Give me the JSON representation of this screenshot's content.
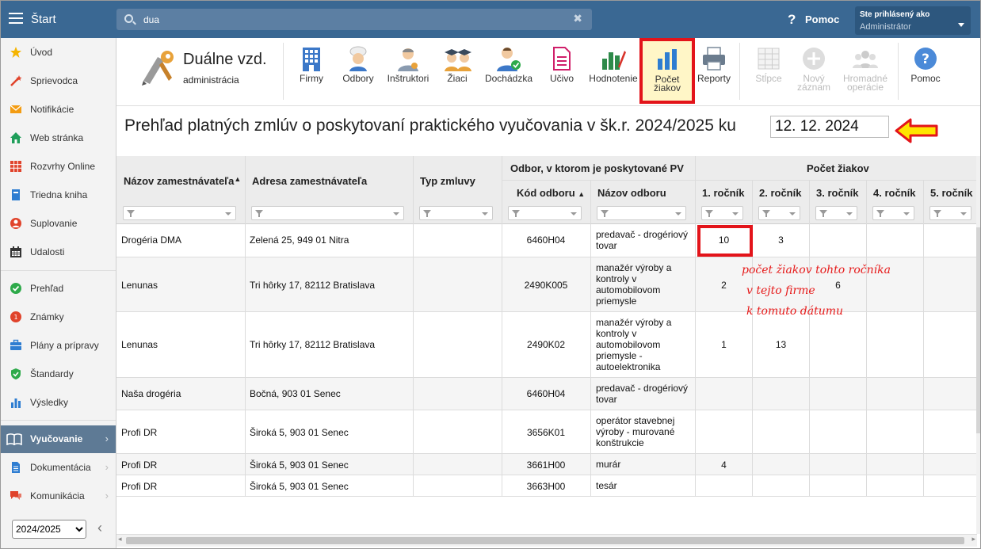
{
  "topbar": {
    "app_title": "Štart",
    "search_value": "dua",
    "help_label": "Pomoc",
    "user_label": "Ste prihlásený ako",
    "user_name": "Administrátor"
  },
  "sidebar": {
    "items": [
      {
        "label": "Úvod",
        "icon": "star-icon",
        "color": "#f5b400"
      },
      {
        "label": "Sprievodca",
        "icon": "magic-wand-icon",
        "color": "#e0432b"
      },
      {
        "label": "Notifikácie",
        "icon": "envelope-icon",
        "color": "#f39c12"
      },
      {
        "label": "Web stránka",
        "icon": "house-icon",
        "color": "#1f9e5a"
      },
      {
        "label": "Rozvrhy Online",
        "icon": "grid-calendar-icon",
        "color": "#e0432b"
      },
      {
        "label": "Triedna kniha",
        "icon": "book-icon",
        "color": "#2e7dd1"
      },
      {
        "label": "Suplovanie",
        "icon": "person-icon",
        "color": "#e0432b"
      },
      {
        "label": "Udalosti",
        "icon": "calendar-icon",
        "color": "#333333"
      },
      {
        "label": "Prehľad",
        "icon": "check-circle-icon",
        "color": "#2eaa4a"
      },
      {
        "label": "Známky",
        "icon": "grades-icon",
        "color": "#e0432b"
      },
      {
        "label": "Plány a prípravy",
        "icon": "briefcase-icon",
        "color": "#2e7dd1"
      },
      {
        "label": "Štandardy",
        "icon": "shield-check-icon",
        "color": "#2eaa4a"
      },
      {
        "label": "Výsledky",
        "icon": "bar-chart-icon",
        "color": "#2e7dd1"
      },
      {
        "label": "Vyučovanie",
        "icon": "open-book-icon",
        "color": "#ffffff"
      },
      {
        "label": "Dokumentácia",
        "icon": "document-icon",
        "color": "#2e7dd1"
      },
      {
        "label": "Komunikácia",
        "icon": "chat-icon",
        "color": "#e0432b"
      }
    ],
    "year_options": [
      "2024/2025"
    ],
    "year_selected": "2024/2025"
  },
  "toolbar": {
    "module_title": "Duálne vzd.",
    "module_subtitle": "administrácia",
    "buttons": [
      {
        "label": "Firmy",
        "icon": "building-icon"
      },
      {
        "label": "Odbory",
        "icon": "chef-icon"
      },
      {
        "label": "Inštruktori",
        "icon": "instructor-icon"
      },
      {
        "label": "Žiaci",
        "icon": "graduates-icon"
      },
      {
        "label": "Dochádzka",
        "icon": "attendance-icon"
      },
      {
        "label": "Učivo",
        "icon": "curriculum-icon"
      },
      {
        "label": "Hodnotenie",
        "icon": "evaluation-icon"
      },
      {
        "label": "Počet žiakov",
        "icon": "bar-chart-icon"
      },
      {
        "label": "Reporty",
        "icon": "printer-icon"
      },
      {
        "label": "Stĺpce",
        "icon": "columns-icon"
      },
      {
        "label": "Nový záznam",
        "icon": "plus-circle-icon"
      },
      {
        "label": "Hromadné operácie",
        "icon": "group-icon"
      },
      {
        "label": "Pomoc",
        "icon": "help-icon"
      }
    ]
  },
  "main": {
    "heading": "Prehľad platných zmlúv o poskytovaní praktického vyučovania v šk.r. 2024/2025 ku",
    "date_value": "12. 12. 2024"
  },
  "table": {
    "headers": {
      "employer": "Názov zamestnávateľa",
      "address": "Adresa zamestnávateľa",
      "type": "Typ zmluvy",
      "field_group": "Odbor, v ktorom je poskytované PV",
      "code": "Kód odboru",
      "field": "Názov odboru",
      "count_group": "Počet žiakov",
      "years": [
        "1. ročník",
        "2. ročník",
        "3. ročník",
        "4. ročník",
        "5. ročník"
      ]
    },
    "rows": [
      {
        "employer": "Drogéria DMA",
        "address": "Zelená 25, 949 01 Nitra",
        "type": "",
        "code": "6460H04",
        "field": "predavač - drogériový tovar",
        "y1": "10",
        "y2": "3",
        "y3": "",
        "y4": "",
        "y5": ""
      },
      {
        "employer": "Lenunas",
        "address": "Tri hôrky 17, 82112 Bratislava",
        "type": "",
        "code": "2490K005",
        "field": "manažér výroby a kontroly v automobilovom priemysle",
        "y1": "2",
        "y2": "",
        "y3": "6",
        "y4": "",
        "y5": ""
      },
      {
        "employer": "Lenunas",
        "address": "Tri hôrky 17, 82112 Bratislava",
        "type": "",
        "code": "2490K02",
        "field": "manažér výroby a kontroly v automobilovom priemysle - autoelektronika",
        "y1": "1",
        "y2": "13",
        "y3": "",
        "y4": "",
        "y5": ""
      },
      {
        "employer": "Naša drogéria",
        "address": "Bočná, 903 01 Senec",
        "type": "",
        "code": "6460H04",
        "field": "predavač - drogériový tovar",
        "y1": "",
        "y2": "",
        "y3": "",
        "y4": "",
        "y5": ""
      },
      {
        "employer": "Profi DR",
        "address": "Široká 5, 903 01 Senec",
        "type": "",
        "code": "3656K01",
        "field": "operátor stavebnej výroby - murované konštrukcie",
        "y1": "",
        "y2": "",
        "y3": "",
        "y4": "",
        "y5": ""
      },
      {
        "employer": "Profi DR",
        "address": "Široká 5, 903 01 Senec",
        "type": "",
        "code": "3661H00",
        "field": "murár",
        "y1": "4",
        "y2": "",
        "y3": "",
        "y4": "",
        "y5": ""
      },
      {
        "employer": "Profi DR",
        "address": "Široká 5, 903 01 Senec",
        "type": "",
        "code": "3663H00",
        "field": "tesár",
        "y1": "",
        "y2": "",
        "y3": "",
        "y4": "",
        "y5": ""
      }
    ]
  },
  "annotation": {
    "lines": [
      "počet žiakov tohto ročníka",
      "v tejto firme",
      "k tomuto dátumu"
    ],
    "color": "#e61a1a"
  }
}
